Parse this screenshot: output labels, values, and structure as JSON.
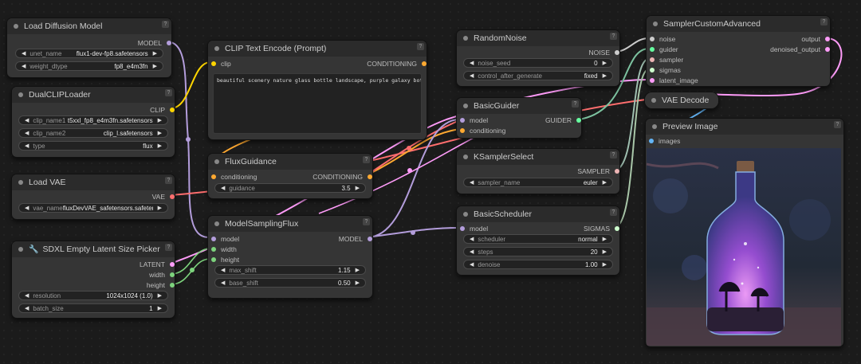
{
  "colors": {
    "model": "#b39ddb",
    "clip": "#ffd500",
    "conditioning": "#ffa931",
    "vae": "#ff6e6e",
    "latent": "#ff9cf9",
    "int": "#7dd37d",
    "noise": "#cccccc",
    "guider": "#66ffa0",
    "sampler": "#ecb4b4",
    "sigmas": "#cdffcd",
    "image": "#64b5f6"
  },
  "nodes": {
    "load_diffusion": {
      "title": "Load Diffusion Model",
      "out_model": "MODEL",
      "w_unet_label": "unet_name",
      "w_unet_value": "flux1-dev-fp8.safetensors",
      "w_dtype_label": "weight_dtype",
      "w_dtype_value": "fp8_e4m3fn"
    },
    "dualclip": {
      "title": "DualCLIPLoader",
      "out_clip": "CLIP",
      "w_clip1_label": "clip_name1",
      "w_clip1_value": "t5xxl_fp8_e4m3fn.safetensors",
      "w_clip2_label": "clip_name2",
      "w_clip2_value": "clip_l.safetensors",
      "w_type_label": "type",
      "w_type_value": "flux"
    },
    "loadvae": {
      "title": "Load VAE",
      "out_vae": "VAE",
      "w_vae_label": "vae_name",
      "w_vae_value": "fluxDevVAE_safetensors.safetensors"
    },
    "sdxl": {
      "title": "SDXL Empty Latent Size Picker",
      "out_latent": "LATENT",
      "out_width": "width",
      "out_height": "height",
      "w_res_label": "resolution",
      "w_res_value": "1024x1024 (1.0)",
      "w_batch_label": "batch_size",
      "w_batch_value": "1"
    },
    "clipenc": {
      "title": "CLIP Text Encode (Prompt)",
      "in_clip": "clip",
      "out_cond": "CONDITIONING",
      "text": "beautiful scenery nature glass bottle landscape, purple galaxy bottle,"
    },
    "fluxguid": {
      "title": "FluxGuidance",
      "in_cond": "conditioning",
      "out_cond": "CONDITIONING",
      "w_guid_label": "guidance",
      "w_guid_value": "3.5"
    },
    "msf": {
      "title": "ModelSamplingFlux",
      "in_model": "model",
      "in_width": "width",
      "in_height": "height",
      "out_model": "MODEL",
      "w_max_label": "max_shift",
      "w_max_value": "1.15",
      "w_base_label": "base_shift",
      "w_base_value": "0.50"
    },
    "randomnoise": {
      "title": "RandomNoise",
      "out_noise": "NOISE",
      "w_seed_label": "noise_seed",
      "w_seed_value": "0",
      "w_ctrl_label": "control_after_generate",
      "w_ctrl_value": "fixed"
    },
    "basicguider": {
      "title": "BasicGuider",
      "in_model": "model",
      "in_cond": "conditioning",
      "out_guider": "GUIDER"
    },
    "ksampler": {
      "title": "KSamplerSelect",
      "out_sampler": "SAMPLER",
      "w_name_label": "sampler_name",
      "w_name_value": "euler"
    },
    "basicsched": {
      "title": "BasicScheduler",
      "in_model": "model",
      "out_sigmas": "SIGMAS",
      "w_sched_label": "scheduler",
      "w_sched_value": "normal",
      "w_steps_label": "steps",
      "w_steps_value": "20",
      "w_denoise_label": "denoise",
      "w_denoise_value": "1.00"
    },
    "sca": {
      "title": "SamplerCustomAdvanced",
      "in_noise": "noise",
      "in_guider": "guider",
      "in_sampler": "sampler",
      "in_sigmas": "sigmas",
      "in_latent": "latent_image",
      "out_output": "output",
      "out_denoised": "denoised_output"
    },
    "vaedecode": {
      "title": "VAE Decode"
    },
    "preview": {
      "title": "Preview Image",
      "in_images": "images"
    }
  }
}
